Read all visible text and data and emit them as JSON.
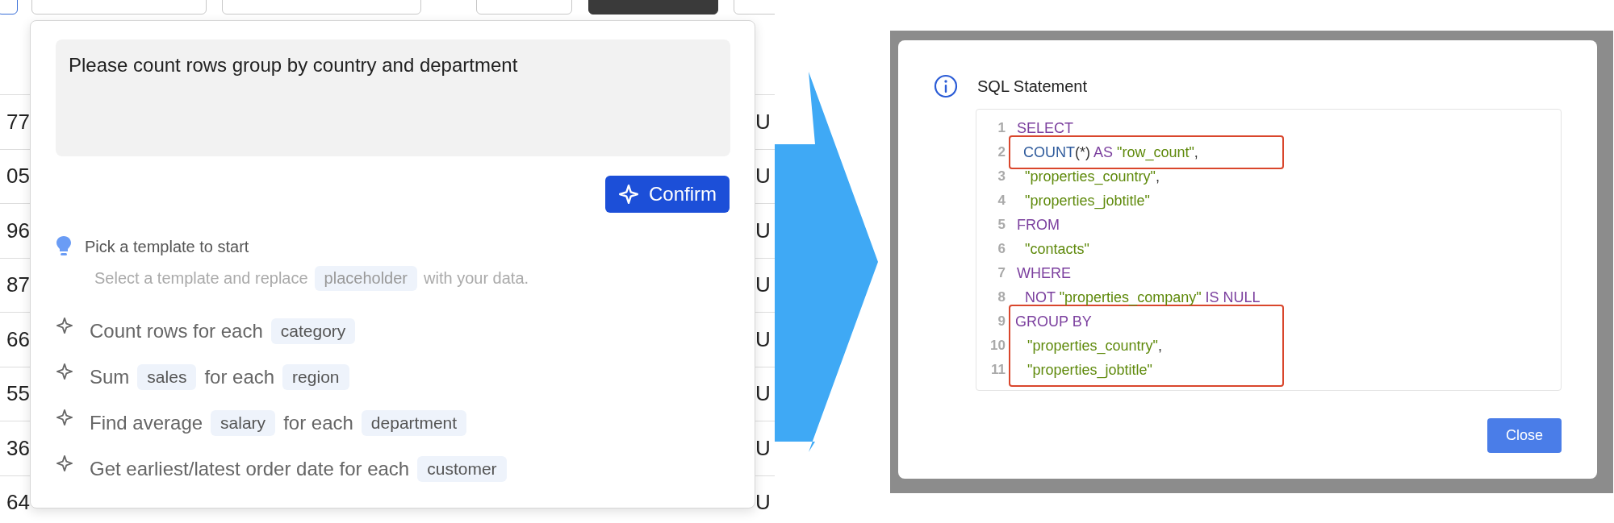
{
  "background_table": {
    "rows": [
      {
        "id_fragment": "77",
        "column_fragment": "U"
      },
      {
        "id_fragment": "05",
        "column_fragment": "U"
      },
      {
        "id_fragment": "96",
        "column_fragment": "U"
      },
      {
        "id_fragment": "87",
        "column_fragment": "U"
      },
      {
        "id_fragment": "66",
        "column_fragment": "U"
      },
      {
        "id_fragment": "55",
        "column_fragment": "U"
      },
      {
        "id_fragment": "36",
        "column_fragment": "U"
      },
      {
        "id_fragment": "64",
        "column_fragment": "U"
      }
    ]
  },
  "ai_popover": {
    "prompt": {
      "value": "Please count rows group by country and department"
    },
    "confirm_button": "Confirm",
    "templates_heading": "Pick a template to start",
    "templates_hint": [
      {
        "kind": "text",
        "text": "Select a template and replace"
      },
      {
        "kind": "chip",
        "text": "placeholder"
      },
      {
        "kind": "text",
        "text": "with your data."
      }
    ],
    "templates": [
      {
        "segments": [
          {
            "kind": "text",
            "text": "Count rows for each"
          },
          {
            "kind": "chip",
            "text": "category"
          }
        ]
      },
      {
        "segments": [
          {
            "kind": "text",
            "text": "Sum"
          },
          {
            "kind": "chip",
            "text": "sales"
          },
          {
            "kind": "text",
            "text": "for each"
          },
          {
            "kind": "chip",
            "text": "region"
          }
        ]
      },
      {
        "segments": [
          {
            "kind": "text",
            "text": "Find average"
          },
          {
            "kind": "chip",
            "text": "salary"
          },
          {
            "kind": "text",
            "text": "for each"
          },
          {
            "kind": "chip",
            "text": "department"
          }
        ]
      },
      {
        "segments": [
          {
            "kind": "text",
            "text": "Get earliest/latest order date for each"
          },
          {
            "kind": "chip",
            "text": "customer"
          }
        ]
      }
    ]
  },
  "sql_dialog": {
    "title": "SQL Statement",
    "code_blocks": [
      {
        "highlighted": false,
        "lines": [
          {
            "number": "1",
            "tokens": [
              {
                "kind": "keyword",
                "text": "SELECT"
              }
            ]
          }
        ]
      },
      {
        "highlighted": true,
        "lines": [
          {
            "number": "2",
            "tokens": [
              {
                "kind": "function",
                "text": "  COUNT"
              },
              {
                "kind": "plain",
                "text": "(*) "
              },
              {
                "kind": "keyword",
                "text": "AS "
              },
              {
                "kind": "string",
                "text": "\"row_count\""
              },
              {
                "kind": "plain",
                "text": ","
              }
            ]
          }
        ]
      },
      {
        "highlighted": false,
        "lines": [
          {
            "number": "3",
            "tokens": [
              {
                "kind": "string",
                "text": "  \"properties_country\""
              },
              {
                "kind": "plain",
                "text": ","
              }
            ]
          },
          {
            "number": "4",
            "tokens": [
              {
                "kind": "string",
                "text": "  \"properties_jobtitle\""
              }
            ]
          },
          {
            "number": "5",
            "tokens": [
              {
                "kind": "keyword",
                "text": "FROM"
              }
            ]
          },
          {
            "number": "6",
            "tokens": [
              {
                "kind": "string",
                "text": "  \"contacts\""
              }
            ]
          },
          {
            "number": "7",
            "tokens": [
              {
                "kind": "keyword",
                "text": "WHERE"
              }
            ]
          },
          {
            "number": "8",
            "tokens": [
              {
                "kind": "keyword",
                "text": "  NOT "
              },
              {
                "kind": "string",
                "text": "\"properties_company\""
              },
              {
                "kind": "keyword",
                "text": " IS NULL"
              }
            ]
          }
        ]
      },
      {
        "highlighted": true,
        "lines": [
          {
            "number": "9",
            "tokens": [
              {
                "kind": "keyword",
                "text": "GROUP BY"
              }
            ]
          },
          {
            "number": "10",
            "tokens": [
              {
                "kind": "string",
                "text": "   \"properties_country\""
              },
              {
                "kind": "plain",
                "text": ","
              }
            ]
          },
          {
            "number": "11",
            "tokens": [
              {
                "kind": "string",
                "text": "   \"properties_jobtitle\""
              }
            ]
          }
        ]
      }
    ],
    "close_button": "Close"
  }
}
